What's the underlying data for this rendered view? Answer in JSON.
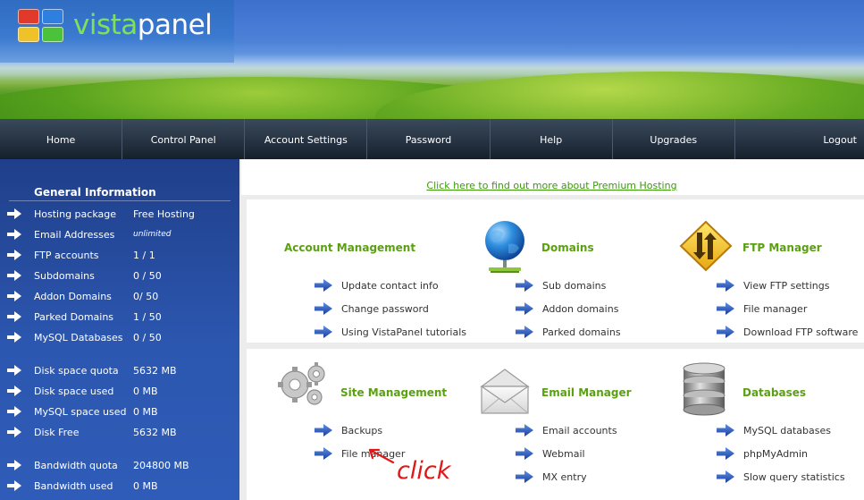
{
  "header": {
    "logo_part1": "vista",
    "logo_part2": "panel"
  },
  "nav": {
    "items": [
      "Home",
      "Control Panel",
      "Account Settings",
      "Password",
      "Help",
      "Upgrades",
      "Logout"
    ]
  },
  "sidebar": {
    "title": "General Information",
    "rows": [
      {
        "label": "Hosting package",
        "value": "Free Hosting"
      },
      {
        "label": "Email Addresses",
        "value": "unlimited"
      },
      {
        "label": "FTP accounts",
        "value": "1 / 1"
      },
      {
        "label": "Subdomains",
        "value": "0 / 50"
      },
      {
        "label": "Addon Domains",
        "value": "0/ 50"
      },
      {
        "label": "Parked Domains",
        "value": "1 / 50"
      },
      {
        "label": "MySQL Databases",
        "value": "0 / 50"
      },
      {
        "label": "Disk space quota",
        "value": "5632 MB"
      },
      {
        "label": "Disk space used",
        "value": "0 MB"
      },
      {
        "label": "MySQL space used",
        "value": "0 MB"
      },
      {
        "label": "Disk Free",
        "value": "5632 MB"
      },
      {
        "label": "Bandwidth quota",
        "value": "204800 MB"
      },
      {
        "label": "Bandwidth used",
        "value": "0 MB"
      }
    ]
  },
  "promo": {
    "link_text": "Click here to find out more about Premium Hosting"
  },
  "sections": {
    "account": {
      "title": "Account Management",
      "links": [
        "Update contact info",
        "Change password",
        "Using VistaPanel tutorials"
      ]
    },
    "domains": {
      "title": "Domains",
      "icon": "globe-icon",
      "links": [
        "Sub domains",
        "Addon domains",
        "Parked domains"
      ]
    },
    "ftp": {
      "title": "FTP Manager",
      "icon": "ftp-sign-icon",
      "links": [
        "View FTP settings",
        "File manager",
        "Download FTP software"
      ]
    },
    "site": {
      "title": "Site Management",
      "icon": "gears-icon",
      "links": [
        "Backups",
        "File manager"
      ]
    },
    "email": {
      "title": "Email Manager",
      "icon": "envelope-icon",
      "links": [
        "Email accounts",
        "Webmail",
        "MX entry"
      ]
    },
    "databases": {
      "title": "Databases",
      "icon": "database-icon",
      "links": [
        "MySQL databases",
        "phpMyAdmin",
        "Slow query statistics"
      ]
    }
  },
  "annotation": {
    "text": "click",
    "color": "#e01818"
  },
  "colors": {
    "section_title": "#5aa010",
    "link_arrow": "#1f4fb0",
    "sidebar_bg": "#2c57b0",
    "nav_bg": "#16202c"
  }
}
